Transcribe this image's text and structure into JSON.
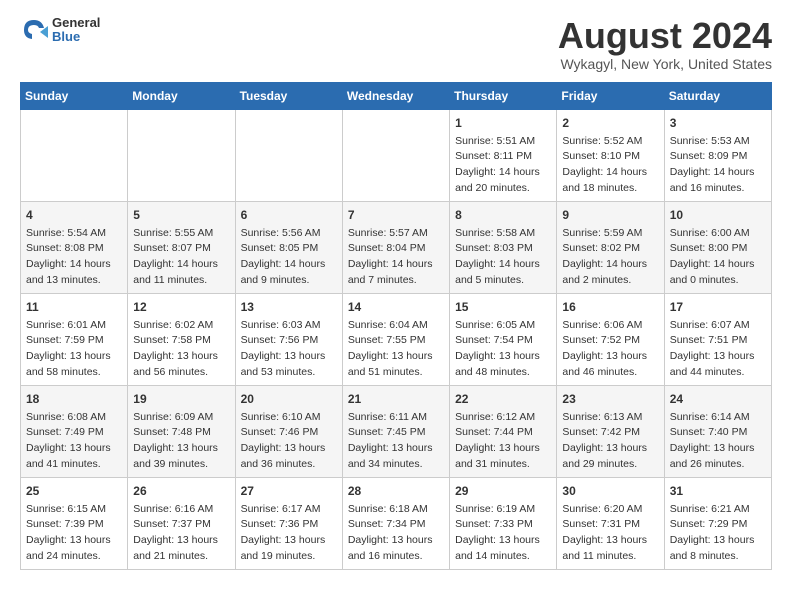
{
  "logo": {
    "general": "General",
    "blue": "Blue"
  },
  "title": "August 2024",
  "subtitle": "Wykagyl, New York, United States",
  "weekdays": [
    "Sunday",
    "Monday",
    "Tuesday",
    "Wednesday",
    "Thursday",
    "Friday",
    "Saturday"
  ],
  "weeks": [
    [
      {
        "day": "",
        "info": ""
      },
      {
        "day": "",
        "info": ""
      },
      {
        "day": "",
        "info": ""
      },
      {
        "day": "",
        "info": ""
      },
      {
        "day": "1",
        "info": "Sunrise: 5:51 AM\nSunset: 8:11 PM\nDaylight: 14 hours\nand 20 minutes."
      },
      {
        "day": "2",
        "info": "Sunrise: 5:52 AM\nSunset: 8:10 PM\nDaylight: 14 hours\nand 18 minutes."
      },
      {
        "day": "3",
        "info": "Sunrise: 5:53 AM\nSunset: 8:09 PM\nDaylight: 14 hours\nand 16 minutes."
      }
    ],
    [
      {
        "day": "4",
        "info": "Sunrise: 5:54 AM\nSunset: 8:08 PM\nDaylight: 14 hours\nand 13 minutes."
      },
      {
        "day": "5",
        "info": "Sunrise: 5:55 AM\nSunset: 8:07 PM\nDaylight: 14 hours\nand 11 minutes."
      },
      {
        "day": "6",
        "info": "Sunrise: 5:56 AM\nSunset: 8:05 PM\nDaylight: 14 hours\nand 9 minutes."
      },
      {
        "day": "7",
        "info": "Sunrise: 5:57 AM\nSunset: 8:04 PM\nDaylight: 14 hours\nand 7 minutes."
      },
      {
        "day": "8",
        "info": "Sunrise: 5:58 AM\nSunset: 8:03 PM\nDaylight: 14 hours\nand 5 minutes."
      },
      {
        "day": "9",
        "info": "Sunrise: 5:59 AM\nSunset: 8:02 PM\nDaylight: 14 hours\nand 2 minutes."
      },
      {
        "day": "10",
        "info": "Sunrise: 6:00 AM\nSunset: 8:00 PM\nDaylight: 14 hours\nand 0 minutes."
      }
    ],
    [
      {
        "day": "11",
        "info": "Sunrise: 6:01 AM\nSunset: 7:59 PM\nDaylight: 13 hours\nand 58 minutes."
      },
      {
        "day": "12",
        "info": "Sunrise: 6:02 AM\nSunset: 7:58 PM\nDaylight: 13 hours\nand 56 minutes."
      },
      {
        "day": "13",
        "info": "Sunrise: 6:03 AM\nSunset: 7:56 PM\nDaylight: 13 hours\nand 53 minutes."
      },
      {
        "day": "14",
        "info": "Sunrise: 6:04 AM\nSunset: 7:55 PM\nDaylight: 13 hours\nand 51 minutes."
      },
      {
        "day": "15",
        "info": "Sunrise: 6:05 AM\nSunset: 7:54 PM\nDaylight: 13 hours\nand 48 minutes."
      },
      {
        "day": "16",
        "info": "Sunrise: 6:06 AM\nSunset: 7:52 PM\nDaylight: 13 hours\nand 46 minutes."
      },
      {
        "day": "17",
        "info": "Sunrise: 6:07 AM\nSunset: 7:51 PM\nDaylight: 13 hours\nand 44 minutes."
      }
    ],
    [
      {
        "day": "18",
        "info": "Sunrise: 6:08 AM\nSunset: 7:49 PM\nDaylight: 13 hours\nand 41 minutes."
      },
      {
        "day": "19",
        "info": "Sunrise: 6:09 AM\nSunset: 7:48 PM\nDaylight: 13 hours\nand 39 minutes."
      },
      {
        "day": "20",
        "info": "Sunrise: 6:10 AM\nSunset: 7:46 PM\nDaylight: 13 hours\nand 36 minutes."
      },
      {
        "day": "21",
        "info": "Sunrise: 6:11 AM\nSunset: 7:45 PM\nDaylight: 13 hours\nand 34 minutes."
      },
      {
        "day": "22",
        "info": "Sunrise: 6:12 AM\nSunset: 7:44 PM\nDaylight: 13 hours\nand 31 minutes."
      },
      {
        "day": "23",
        "info": "Sunrise: 6:13 AM\nSunset: 7:42 PM\nDaylight: 13 hours\nand 29 minutes."
      },
      {
        "day": "24",
        "info": "Sunrise: 6:14 AM\nSunset: 7:40 PM\nDaylight: 13 hours\nand 26 minutes."
      }
    ],
    [
      {
        "day": "25",
        "info": "Sunrise: 6:15 AM\nSunset: 7:39 PM\nDaylight: 13 hours\nand 24 minutes."
      },
      {
        "day": "26",
        "info": "Sunrise: 6:16 AM\nSunset: 7:37 PM\nDaylight: 13 hours\nand 21 minutes."
      },
      {
        "day": "27",
        "info": "Sunrise: 6:17 AM\nSunset: 7:36 PM\nDaylight: 13 hours\nand 19 minutes."
      },
      {
        "day": "28",
        "info": "Sunrise: 6:18 AM\nSunset: 7:34 PM\nDaylight: 13 hours\nand 16 minutes."
      },
      {
        "day": "29",
        "info": "Sunrise: 6:19 AM\nSunset: 7:33 PM\nDaylight: 13 hours\nand 14 minutes."
      },
      {
        "day": "30",
        "info": "Sunrise: 6:20 AM\nSunset: 7:31 PM\nDaylight: 13 hours\nand 11 minutes."
      },
      {
        "day": "31",
        "info": "Sunrise: 6:21 AM\nSunset: 7:29 PM\nDaylight: 13 hours\nand 8 minutes."
      }
    ]
  ]
}
